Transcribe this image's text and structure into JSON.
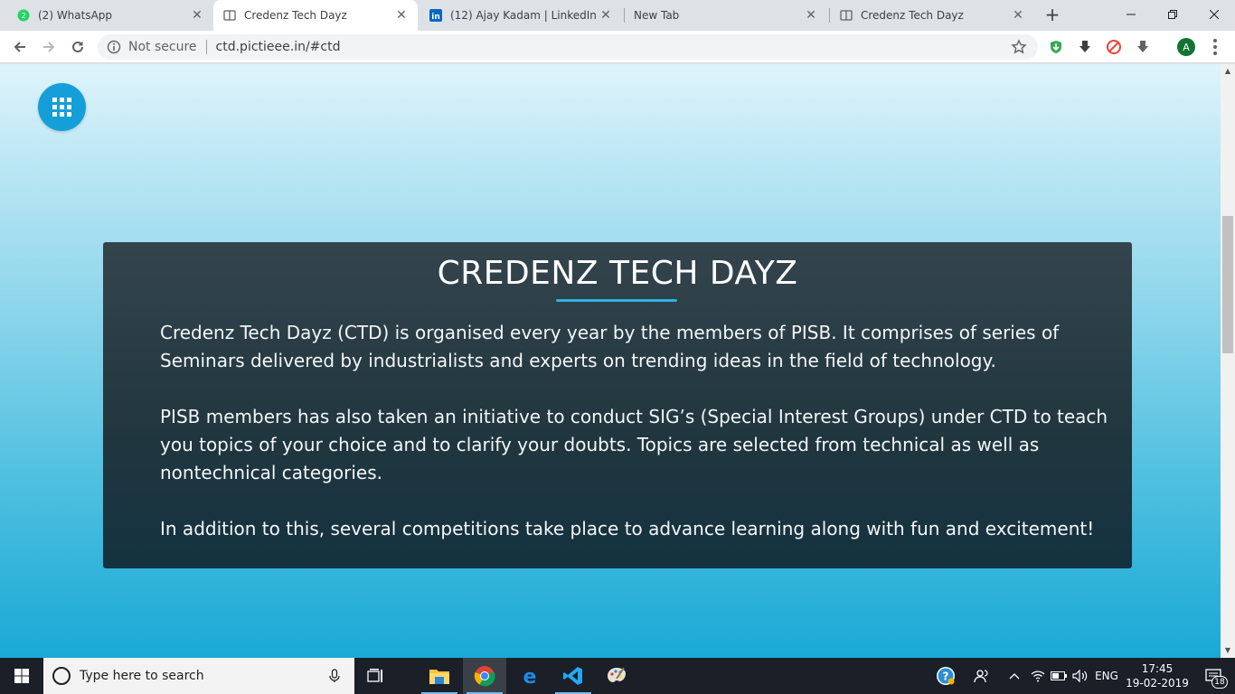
{
  "browser": {
    "tabs": [
      {
        "title": "(2) WhatsApp",
        "icon": "whatsapp-icon",
        "active": false
      },
      {
        "title": "Credenz Tech Dayz",
        "icon": "page-icon",
        "active": true
      },
      {
        "title": "(12) Ajay Kadam | LinkedIn",
        "icon": "linkedin-icon",
        "active": false
      },
      {
        "title": "New Tab",
        "icon": "",
        "active": false
      },
      {
        "title": "Credenz Tech Dayz",
        "icon": "page-icon",
        "active": false
      }
    ],
    "whatsapp_badge": "2",
    "new_tab_symbol": "+",
    "omnibox": {
      "security_label": "Not secure",
      "url": "ctd.pictieee.in/#ctd"
    },
    "profile_initial": "A"
  },
  "page": {
    "menu_button_icon": "grid-icon",
    "section": {
      "title": "CREDENZ TECH DAYZ",
      "paragraphs": [
        "Credenz Tech Dayz (CTD) is organised every year by the members of PISB. It comprises of series of Seminars delivered by industrialists and experts on trending ideas in the field of technology.",
        "PISB members has also taken an initiative to conduct SIG’s (Special Interest Groups) under CTD to teach you topics of your choice and to clarify your doubts. Topics are selected from technical as well as nontechnical categories.",
        "In addition to this, several competitions take place to advance learning along with fun and excitement!"
      ]
    }
  },
  "taskbar": {
    "search_placeholder": "Type here to search",
    "language": "ENG",
    "time": "17:45",
    "date": "19-02-2019",
    "notification_count": "18"
  },
  "colors": {
    "accent": "#2eb3e6",
    "fab": "#159fd8",
    "card_top": "#34444d",
    "card_bottom": "#143240"
  }
}
